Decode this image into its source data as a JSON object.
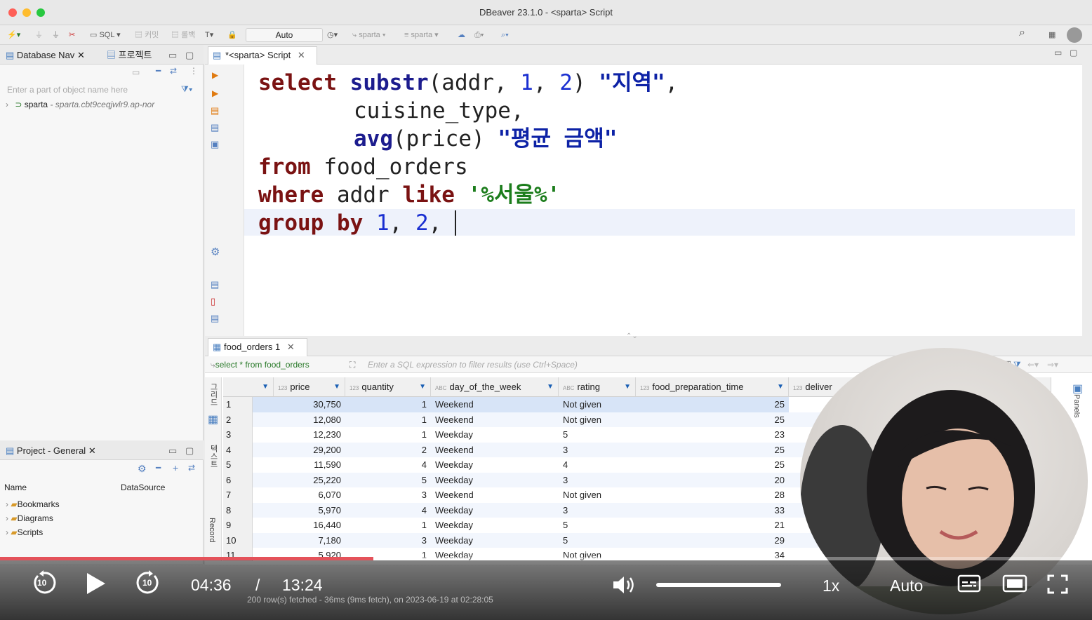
{
  "window": {
    "title": "DBeaver 23.1.0 - <sparta> Script"
  },
  "toolbar": {
    "sql_label": "SQL",
    "commit_label": "커밋",
    "rollback_label": "롤백",
    "transaction_mode": "Auto",
    "datasource_1": "sparta",
    "datasource_2": "sparta"
  },
  "left_panel": {
    "db_nav_tab": "Database Nav",
    "project_tab": "프로젝트",
    "search_placeholder": "Enter a part of object name here",
    "connection": {
      "name": "sparta",
      "host": "- sparta.cbt9ceqjwlr9.ap-nor"
    },
    "project_panel_title": "Project - General",
    "project_columns": {
      "name": "Name",
      "datasource": "DataSource"
    },
    "project_items": [
      "Bookmarks",
      "Diagrams",
      "Scripts"
    ]
  },
  "editor": {
    "tab_label": "*<sparta> Script",
    "code": {
      "l1": {
        "kw": "select",
        "fn": "substr",
        "open": "(addr, ",
        "n1": "1",
        "comma": ", ",
        "n2": "2",
        "close": ") ",
        "alias": "\"지역\"",
        "end": ","
      },
      "l2": {
        "text": "cuisine_type,"
      },
      "l3": {
        "fn": "avg",
        "args": "(price) ",
        "alias": "\"평균 금액\""
      },
      "l4": {
        "kw": "from",
        "rest": " food_orders"
      },
      "l5": {
        "kw1": "where",
        "mid": " addr ",
        "kw2": "like",
        "sp": " ",
        "literal": "'%서울%'"
      },
      "l6": {
        "kw": "group by",
        "sp": " ",
        "n1": "1",
        "c1": ", ",
        "n2": "2",
        "c2": ", "
      }
    }
  },
  "results": {
    "tab_label": "food_orders 1",
    "query_label": "select * from food_orders",
    "filter_placeholder": "Enter a SQL expression to filter results (use Ctrl+Space)",
    "side_labels": {
      "grid": "그리드",
      "text": "텍스트",
      "record": "Record"
    },
    "panels_label": "Panels",
    "columns": [
      {
        "type": "123",
        "name": "price"
      },
      {
        "type": "123",
        "name": "quantity"
      },
      {
        "type": "ABC",
        "name": "day_of_the_week"
      },
      {
        "type": "ABC",
        "name": "rating"
      },
      {
        "type": "123",
        "name": "food_preparation_time"
      },
      {
        "type": "123",
        "name": "deliver"
      }
    ],
    "rows": [
      {
        "n": "1",
        "price": "30,750",
        "quantity": "1",
        "day": "Weekend",
        "rating": "Not given",
        "prep": "25"
      },
      {
        "n": "2",
        "price": "12,080",
        "quantity": "1",
        "day": "Weekend",
        "rating": "Not given",
        "prep": "25"
      },
      {
        "n": "3",
        "price": "12,230",
        "quantity": "1",
        "day": "Weekday",
        "rating": "5",
        "prep": "23"
      },
      {
        "n": "4",
        "price": "29,200",
        "quantity": "2",
        "day": "Weekend",
        "rating": "3",
        "prep": "25"
      },
      {
        "n": "5",
        "price": "11,590",
        "quantity": "4",
        "day": "Weekday",
        "rating": "4",
        "prep": "25"
      },
      {
        "n": "6",
        "price": "25,220",
        "quantity": "5",
        "day": "Weekday",
        "rating": "3",
        "prep": "20"
      },
      {
        "n": "7",
        "price": "6,070",
        "quantity": "3",
        "day": "Weekend",
        "rating": "Not given",
        "prep": "28"
      },
      {
        "n": "8",
        "price": "5,970",
        "quantity": "4",
        "day": "Weekday",
        "rating": "3",
        "prep": "33"
      },
      {
        "n": "9",
        "price": "16,440",
        "quantity": "1",
        "day": "Weekday",
        "rating": "5",
        "prep": "21"
      },
      {
        "n": "10",
        "price": "7,180",
        "quantity": "3",
        "day": "Weekday",
        "rating": "5",
        "prep": "29"
      },
      {
        "n": "11",
        "price": "5,920",
        "quantity": "1",
        "day": "Weekday",
        "rating": "Not given",
        "prep": "34"
      }
    ],
    "status": "200 row(s) fetched - 36ms (9ms fetch), on 2023-06-19 at 02:28:05"
  },
  "player": {
    "current_time": "04:36",
    "separator": "/",
    "duration": "13:24",
    "progress_fraction": 0.342,
    "volume_fraction": 1.0,
    "speed": "1x",
    "quality": "Auto",
    "skip_seconds": "10",
    "accent_color": "#e4525a"
  }
}
